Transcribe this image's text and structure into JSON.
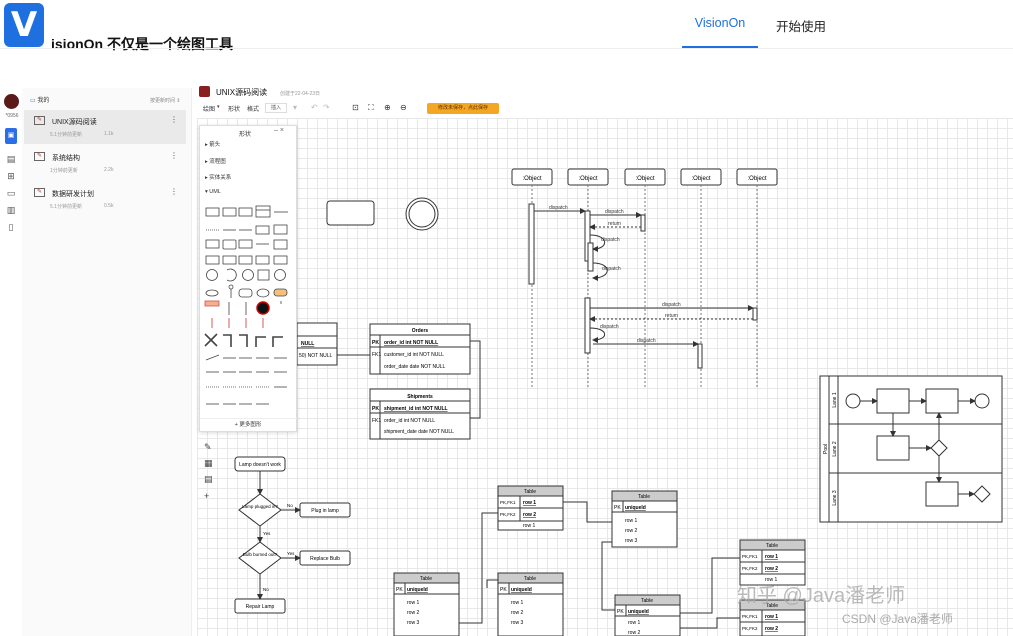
{
  "header": {
    "logo_letter": "V",
    "site_title": "isionOn 不仅是一个绘图工具",
    "nav": [
      "VisionOn",
      "开始使用"
    ],
    "accent_color": "#1e6fe0"
  },
  "rail": {
    "user_label": "*0956"
  },
  "file_list": {
    "header": "我的",
    "sort": "按更新时间 ⇕",
    "items": [
      {
        "name": "UNIX源码阅读",
        "meta": "5.1分钟前更新",
        "size": "1.1k"
      },
      {
        "name": "系统结构",
        "meta": "1分钟前更新",
        "size": "2.2k"
      },
      {
        "name": "数据研发计划",
        "meta": "5.1分钟前更新",
        "size": "0.5k"
      }
    ]
  },
  "editor": {
    "title": "UNIX源码阅读",
    "created": "创建于22-04-23日",
    "toolbar": {
      "menu_draw": "绘图",
      "menu_shape": "形状",
      "menu_style": "格式",
      "insert": "插入",
      "save_warning": "修改未保存，点此保存"
    }
  },
  "panel": {
    "title": "形状",
    "categories": [
      "箭头",
      "流程图",
      "实体关系",
      "UML"
    ],
    "more": "+ 更多图形"
  },
  "diagram": {
    "objects": [
      ":Object",
      ":Object",
      ":Object",
      ":Object",
      ":Object"
    ],
    "messages": [
      "dispatch",
      "dispatch",
      "return",
      "dispatch",
      "dispatch",
      "dispatch",
      "return",
      "dispatch",
      "dispatch"
    ],
    "er": {
      "orders_title": "Orders",
      "orders_rows": [
        {
          "key": "PK",
          "field": "order_id int NOT NULL"
        },
        {
          "key": "FK1",
          "field": "customer_id int NOT NULL"
        },
        {
          "key": "",
          "field": "order_date date NOT NULL"
        }
      ],
      "shipments_title": "Shipments",
      "shipments_rows": [
        {
          "key": "PK",
          "field": "shipment_id int NOT NULL"
        },
        {
          "key": "FK1",
          "field": "order_id int NOT NULL"
        },
        {
          "key": "",
          "field": "shipment_date date NOT NULL"
        }
      ],
      "left_partial": [
        "NULL",
        "50) NOT NULL"
      ]
    },
    "tables": {
      "title": "Table",
      "uniqueid": "uniqueId",
      "row1": "row 1",
      "row2": "row 2",
      "row3": "row 3",
      "pk": "PK",
      "pkfk1": "PK,FK1",
      "pkfk2": "PK,FK2"
    },
    "flow": {
      "start": "Lamp doesn't work",
      "q1": "Lamp plugged in?",
      "a1": "Plug in lamp",
      "q2": "Bulb burned out?",
      "a2": "Replace Bulb",
      "end": "Repair Lamp",
      "yes": "Yes",
      "no": "No"
    },
    "swimlane": {
      "pool": "Pool",
      "lanes": [
        "Lane 1",
        "Lane 2",
        "Lane 3"
      ]
    }
  },
  "watermark": {
    "line1": "知乎 @Java潘老师",
    "line2": "CSDN @Java潘老师"
  }
}
